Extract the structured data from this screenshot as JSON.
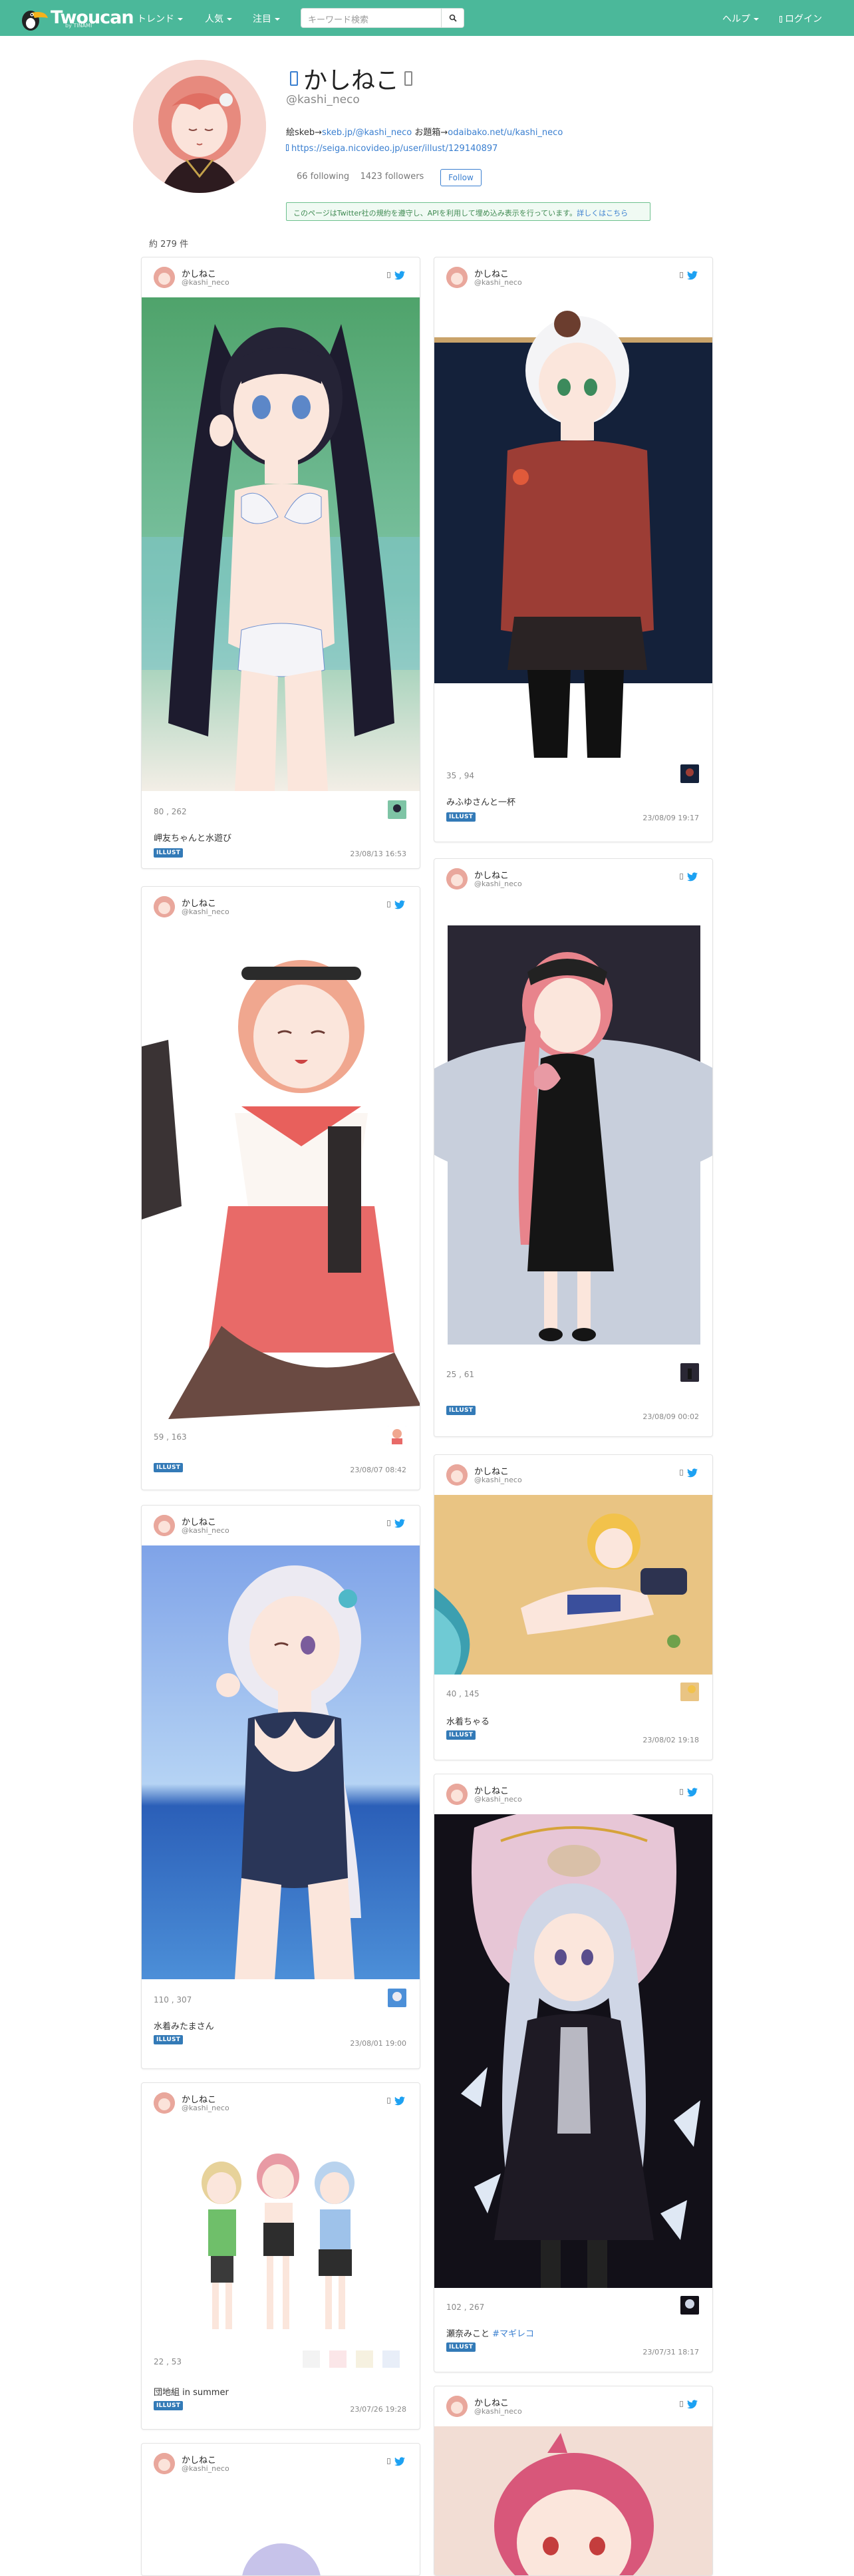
{
  "nav": {
    "logo": "Twoucan",
    "logo_sub": "by TINAMI",
    "items": [
      "トレンド",
      "人気",
      "注目"
    ],
    "search_placeholder": "キーワード検索",
    "help": "ヘルプ",
    "login": "ログイン",
    "brand_color": "#4bb89a"
  },
  "profile": {
    "name": "かしねこ",
    "handle": "@kashi_neco",
    "bio_prefix": "絵",
    "bio_skeb_label": "skeb",
    "bio_skeb_link": "skeb.jp/@kashi_neco",
    "bio_odai_label": "お題箱",
    "bio_odai_link": "odaibako.net/u/kashi_neco",
    "url": "https://seiga.nicovideo.jp/user/illust/129140897",
    "following": "66 following",
    "followers": "1423 followers",
    "follow_label": "Follow",
    "notice_text": "このページはTwitter社の規約を遵守し、APIを利用して埋め込み表示を行っています。",
    "notice_link": "詳しくはこちら",
    "count": "約 279 件"
  },
  "cards": [
    {
      "name": "かしねこ",
      "handle": "@kashi_neco",
      "stats": "80 , 262",
      "title": "岬友ちゃんと水遊び",
      "badge": "ILLUST",
      "date": "23/08/13 16:53"
    },
    {
      "name": "かしねこ",
      "handle": "@kashi_neco",
      "stats": "35 , 94",
      "title": "みふゆさんと一杯",
      "badge": "ILLUST",
      "date": "23/08/09 19:17"
    },
    {
      "name": "かしねこ",
      "handle": "@kashi_neco",
      "stats": "59 , 163",
      "title": "",
      "badge": "ILLUST",
      "date": "23/08/07 08:42"
    },
    {
      "name": "かしねこ",
      "handle": "@kashi_neco",
      "stats": "25 , 61",
      "title": "",
      "badge": "ILLUST",
      "date": "23/08/09 00:02"
    },
    {
      "name": "かしねこ",
      "handle": "@kashi_neco",
      "stats": "110 , 307",
      "title": "水着みたまさん",
      "badge": "ILLUST",
      "date": "23/08/01 19:00"
    },
    {
      "name": "かしねこ",
      "handle": "@kashi_neco",
      "stats": "40 , 145",
      "title": "水着ちゃる",
      "badge": "ILLUST",
      "date": "23/08/02 19:18"
    },
    {
      "name": "かしねこ",
      "handle": "@kashi_neco",
      "stats": "22 , 53",
      "title": "団地組 in summer",
      "badge": "ILLUST",
      "date": "23/07/26 19:28"
    },
    {
      "name": "かしねこ",
      "handle": "@kashi_neco",
      "stats": "102 , 267",
      "title": "瀬奈みこと",
      "title_tag": "#マギレコ",
      "badge": "ILLUST",
      "date": "23/07/31 18:17"
    },
    {
      "name": "かしねこ",
      "handle": "@kashi_neco"
    },
    {
      "name": "かしねこ",
      "handle": "@kashi_neco"
    }
  ]
}
